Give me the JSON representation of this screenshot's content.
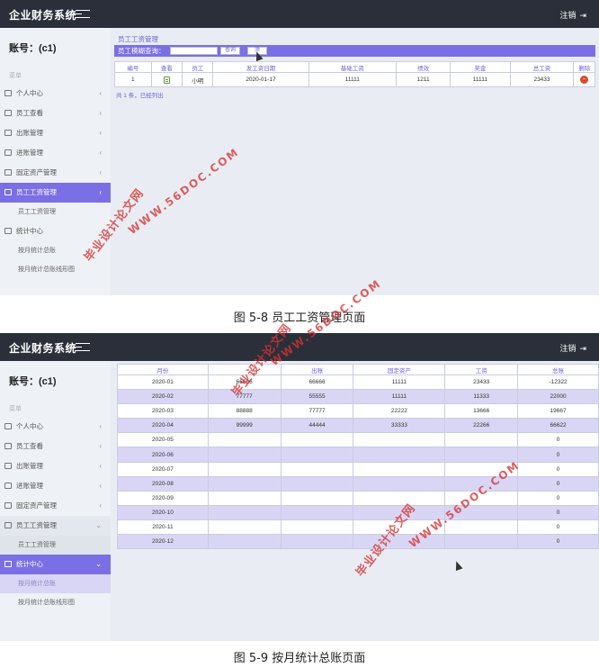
{
  "screen1": {
    "brand": "企业财务系统",
    "logout_label": "注销",
    "account": "账号：(c1)",
    "nav_caption": "菜单",
    "nav": [
      {
        "label": "个人中心"
      },
      {
        "label": "员工查看"
      },
      {
        "label": "出账管理"
      },
      {
        "label": "进账管理"
      },
      {
        "label": "固定资产管理"
      },
      {
        "label": "员工工资管理"
      },
      {
        "label": "员工工资管理"
      },
      {
        "label": "统计中心"
      },
      {
        "label": "按月统计总账"
      },
      {
        "label": "按月统计总账线形图"
      }
    ],
    "panel_title": "员工工资管理",
    "search_label": "员工模糊查询：",
    "search_value": "",
    "query_button": "查询",
    "add_button": "添",
    "table": {
      "headers": [
        "编号",
        "查看",
        "员工",
        "发工资日期",
        "基础工资",
        "绩效",
        "奖金",
        "总工资",
        "删除"
      ],
      "rows": [
        [
          "1",
          "",
          "小明",
          "2020-01-17",
          "11111",
          "1211",
          "11111",
          "23433",
          ""
        ]
      ]
    },
    "total_text": "共 1 条，已经列出"
  },
  "screen2": {
    "brand": "企业财务系统",
    "logout_label": "注销",
    "account": "账号：(c1)",
    "nav_caption": "菜单",
    "nav": [
      {
        "label": "个人中心"
      },
      {
        "label": "员工查看"
      },
      {
        "label": "出账管理"
      },
      {
        "label": "进账管理"
      },
      {
        "label": "固定资产管理"
      },
      {
        "label": "员工工资管理"
      },
      {
        "label": "员工工资管理"
      },
      {
        "label": "统计中心"
      },
      {
        "label": "按月统计总账"
      },
      {
        "label": "按月统计总账线形图"
      }
    ],
    "table": {
      "headers": [
        "月份",
        "",
        "出账",
        "固定资产",
        "工资",
        "总账"
      ],
      "rows": [
        [
          "2020-01",
          "66666",
          "66666",
          "11111",
          "23433",
          "-12322"
        ],
        [
          "2020-02",
          "77777",
          "55555",
          "11111",
          "11333",
          "22000"
        ],
        [
          "2020-03",
          "88888",
          "77777",
          "22222",
          "13666",
          "19667"
        ],
        [
          "2020-04",
          "99999",
          "44444",
          "33333",
          "22266",
          "66622"
        ],
        [
          "2020-05",
          "",
          "",
          "",
          "",
          "0"
        ],
        [
          "2020-06",
          "",
          "",
          "",
          "",
          "0"
        ],
        [
          "2020-07",
          "",
          "",
          "",
          "",
          "0"
        ],
        [
          "2020-08",
          "",
          "",
          "",
          "",
          "0"
        ],
        [
          "2020-09",
          "",
          "",
          "",
          "",
          "0"
        ],
        [
          "2020-10",
          "",
          "",
          "",
          "",
          "0"
        ],
        [
          "2020-11",
          "",
          "",
          "",
          "",
          "0"
        ],
        [
          "2020-12",
          "",
          "",
          "",
          "",
          "0"
        ]
      ]
    }
  },
  "captions": {
    "fig1": "图 5-8 员工工资管理页面",
    "fig2": "图 5-9 按月统计总账页面"
  },
  "watermarks": {
    "text_site": "WWW.56DOC.COM",
    "text_cn": "毕业设计论文网"
  },
  "colors": {
    "topbar": "#2b2f3a",
    "accent": "#7b6fe6",
    "delete": "#e0462a",
    "watermark": "#d63232"
  }
}
